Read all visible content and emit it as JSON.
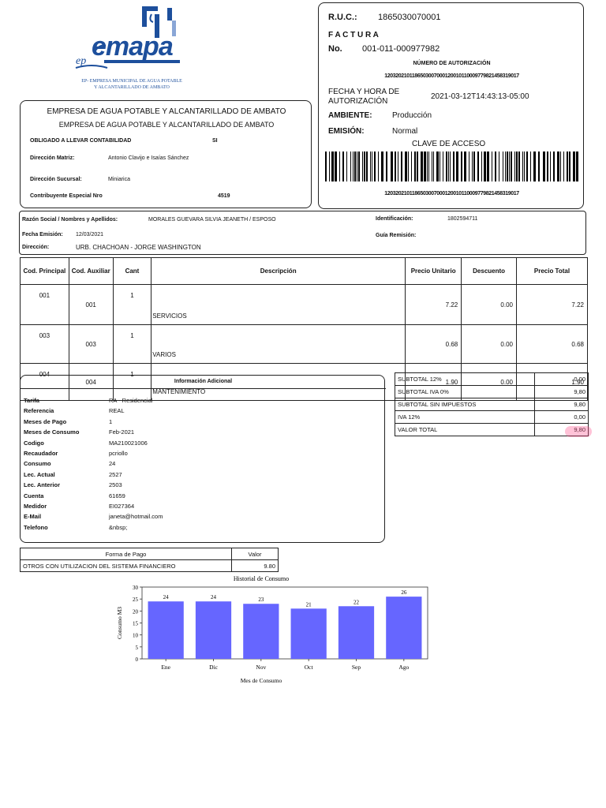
{
  "logo": {
    "brand": "emapa",
    "prefix": "ep",
    "caption_line1": "EP- EMPRESA MUNICIPAL DE AGUA POTABLE",
    "caption_line2": "Y ALCANTARILLADO DE AMBATO",
    "color": "#1d4f9c"
  },
  "invoice": {
    "ruc_label": "R.U.C.:",
    "ruc": "1865030070001",
    "doc_type": "F A C T U R A",
    "no_label": "No.",
    "number": "001-011-000977982",
    "auth_label": "NÚMERO DE AUTORIZACIÓN",
    "auth_number": "1203202101186503007000120010110009779821458319017",
    "date_label_1": "FECHA Y HORA DE",
    "date_label_2": "AUTORIZACIÓN",
    "date": "2021-03-12T14:43:13-05:00",
    "ambiente_label": "AMBIENTE:",
    "ambiente": "Producción",
    "emision_label": "EMISIÓN:",
    "emision": "Normal",
    "clave_label": "CLAVE DE ACCESO",
    "clave": "1203202101186503007000120010110009779821458319017"
  },
  "company": {
    "name1": "EMPRESA DE AGUA POTABLE Y ALCANTARILLADO DE AMBATO",
    "name2": "EMPRESA DE AGUA POTABLE Y ALCANTARILLADO DE AMBATO",
    "obligado_label": "OBLIGADO A LLEVAR CONTABILIDAD",
    "obligado": "SI",
    "matriz_label": "Dirección Matriz:",
    "matriz": "Antonio Clavijo e Isaías Sánchez",
    "sucursal_label": "Dirección Sucursal:",
    "sucursal": "Miniarica",
    "especial_label": "Contribuyente Especial Nro",
    "especial": "4519"
  },
  "client": {
    "razon_label": "Razón Social / Nombres y Apellidos:",
    "razon": "MORALES GUEVARA SILVIA JEANETH / ESPOSO",
    "ident_label": "Identificación:",
    "ident": "1802594711",
    "fecha_label": "Fecha Emisión:",
    "fecha": "12/03/2021",
    "guia_label": "Guía Remisión:",
    "dir_label": "Dirección:",
    "dir": "URB. CHACHOAN - JORGE WASHINGTON"
  },
  "items": {
    "headers": [
      "Cod. Principal",
      "Cod. Auxiliar",
      "Cant",
      "Descripción",
      "Precio Unitario",
      "Descuento",
      "Precio Total"
    ],
    "rows": [
      {
        "cp": "001",
        "ca": "001",
        "cant": "1",
        "desc": "SERVICIOS",
        "pu": "7.22",
        "dto": "0.00",
        "pt": "7.22"
      },
      {
        "cp": "003",
        "ca": "003",
        "cant": "1",
        "desc": "VARIOS",
        "pu": "0.68",
        "dto": "0.00",
        "pt": "0.68"
      },
      {
        "cp": "004",
        "ca": "004",
        "cant": "1",
        "desc": "MANTENIMIENTO",
        "pu": "1.90",
        "dto": "0.00",
        "pt": "1.90"
      }
    ]
  },
  "totals": [
    {
      "label": "SUBTOTAL 12%",
      "value": "0,00"
    },
    {
      "label": "SUBTOTAL IVA 0%",
      "value": "9,80"
    },
    {
      "label": "SUBTOTAL SIN IMPUESTOS",
      "value": "9,80"
    },
    {
      "label": "IVA 12%",
      "value": "0,00"
    },
    {
      "label": "VALOR TOTAL",
      "value": "9,80"
    }
  ],
  "info": {
    "title": "Información Adicional",
    "rows": [
      {
        "label": "Tarifa",
        "value": "RA - Residencial"
      },
      {
        "label": "Referencia",
        "value": "REAL"
      },
      {
        "label": "Meses de Pago",
        "value": "1"
      },
      {
        "label": "Meses de Consumo",
        "value": "Feb-2021"
      },
      {
        "label": "Codigo",
        "value": "MA210021006"
      },
      {
        "label": "Recaudador",
        "value": "pcriollo"
      },
      {
        "label": "Consumo",
        "value": "24"
      },
      {
        "label": "Lec. Actual",
        "value": "2527"
      },
      {
        "label": "Lec. Anterior",
        "value": "2503"
      },
      {
        "label": "Cuenta",
        "value": "61659"
      },
      {
        "label": "Medidor",
        "value": "EI027364"
      },
      {
        "label": "E-Mail",
        "value": "janeta@hotmail.com"
      },
      {
        "label": "Telefono",
        "value": "&nbsp;"
      }
    ]
  },
  "payment": {
    "h_forma": "Forma de Pago",
    "h_valor": "Valor",
    "forma": "OTROS CON UTILIZACION DEL SISTEMA FINANCIERO",
    "valor": "9.80"
  },
  "chart_data": {
    "type": "bar",
    "title": "Historial de Consumo",
    "xlabel": "Mes de Consumo",
    "ylabel": "Consumo M3",
    "categories": [
      "Ene",
      "Dic",
      "Nov",
      "Oct",
      "Sep",
      "Ago"
    ],
    "values": [
      24,
      24,
      23,
      21,
      22,
      26
    ],
    "ylim": [
      0,
      30
    ],
    "yticks": [
      0,
      5,
      10,
      15,
      20,
      25,
      30
    ],
    "bar_color": "#6666ff",
    "grid": false
  }
}
